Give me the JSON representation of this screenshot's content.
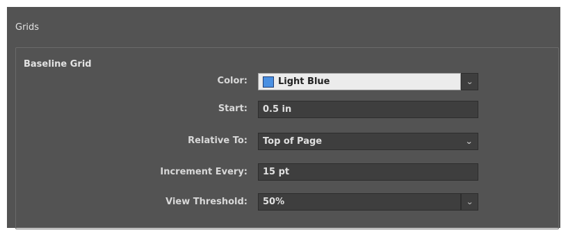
{
  "panel": {
    "title": "Grids"
  },
  "baseline_grid": {
    "title": "Baseline Grid",
    "color": {
      "label": "Color:",
      "value": "Light Blue",
      "swatch": "#4a90e2"
    },
    "start": {
      "label": "Start:",
      "value": "0.5 in"
    },
    "relative_to": {
      "label": "Relative To:",
      "value": "Top of Page"
    },
    "increment_every": {
      "label": "Increment Every:",
      "value": "15 pt"
    },
    "view_threshold": {
      "label": "View Threshold:",
      "value": "50%"
    }
  },
  "icons": {
    "dropdown": "chevron-down-icon",
    "color": "color-swatch"
  }
}
